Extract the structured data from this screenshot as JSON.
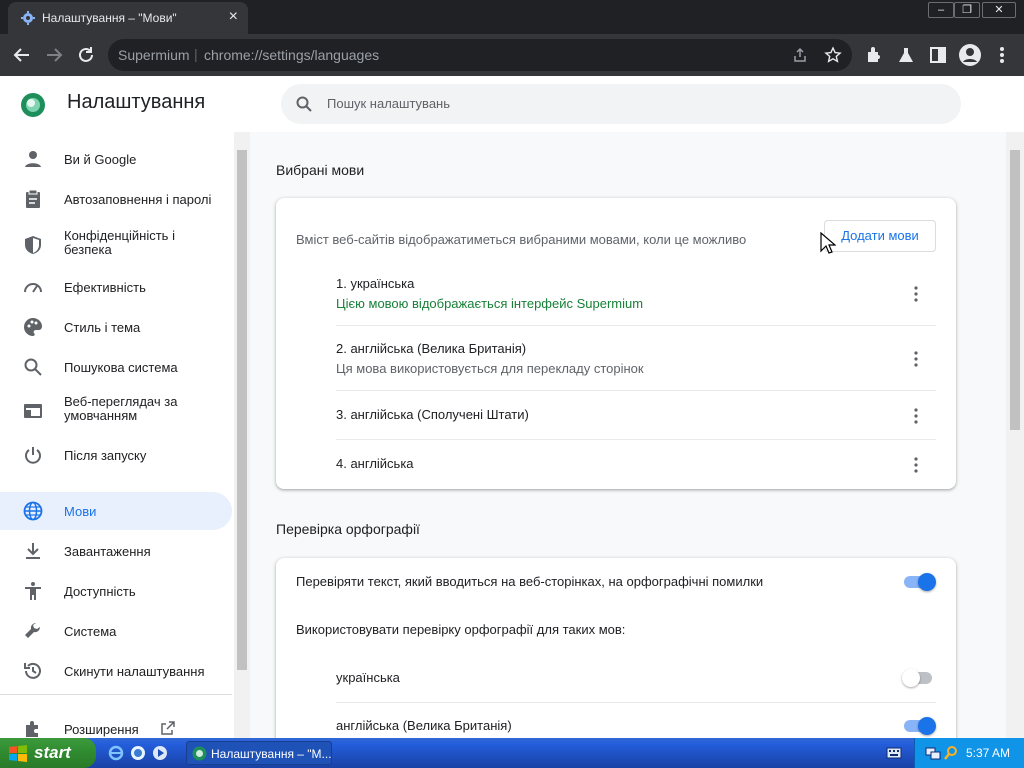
{
  "browser": {
    "tab_title": "Налаштування – \"Мови\"",
    "url_domain": "Supermium",
    "url_path": "chrome://settings/languages",
    "window_buttons": [
      "–",
      "❐",
      "✕"
    ]
  },
  "settings": {
    "title": "Налаштування",
    "search_placeholder": "Пошук налаштувань",
    "sidebar": [
      {
        "label": "Ви й Google",
        "icon": "person-icon"
      },
      {
        "label": "Автозаповнення і паролі",
        "icon": "clipboard-icon"
      },
      {
        "label": "Конфіденційність і безпека",
        "icon": "shield-icon"
      },
      {
        "label": "Ефективність",
        "icon": "speedometer-icon"
      },
      {
        "label": "Стиль і тема",
        "icon": "palette-icon"
      },
      {
        "label": "Пошукова система",
        "icon": "search-icon"
      },
      {
        "label": "Веб-переглядач за умовчанням",
        "icon": "browser-icon"
      },
      {
        "label": "Після запуску",
        "icon": "power-icon"
      },
      {
        "label": "Мови",
        "icon": "globe-icon",
        "active": true
      },
      {
        "label": "Завантаження",
        "icon": "download-icon"
      },
      {
        "label": "Доступність",
        "icon": "accessibility-icon"
      },
      {
        "label": "Система",
        "icon": "wrench-icon"
      },
      {
        "label": "Скинути налаштування",
        "icon": "history-icon"
      },
      {
        "label": "Розширення",
        "icon": "puzzle-icon"
      }
    ],
    "preferred_languages": {
      "section_title": "Вибрані мови",
      "description": "Вміст веб-сайтів відображатиметься вибраними мовами, коли це можливо",
      "add_button": "Додати мови",
      "languages": [
        {
          "name": "1. українська",
          "note": "Цією мовою відображається інтерфейс Supermium"
        },
        {
          "name": "2. англійська (Велика Британія)",
          "note": "Ця мова використовується для перекладу сторінок"
        },
        {
          "name": "3. англійська (Сполучені Штати)",
          "note": ""
        },
        {
          "name": "4. англійська",
          "note": ""
        }
      ]
    },
    "spell_check": {
      "section_title": "Перевірка орфографії",
      "main_label": "Перевіряти текст, який вводиться на веб-сторінках, на орфографічні помилки",
      "main_enabled": true,
      "languages_label": "Використовувати перевірку орфографії для таких мов:",
      "languages": [
        {
          "name": "українська",
          "enabled": false
        },
        {
          "name": "англійська (Велика Британія)",
          "enabled": true
        }
      ]
    }
  },
  "taskbar": {
    "start_label": "start",
    "task_label": "Налаштування – \"М...",
    "clock": "5:37 AM"
  },
  "colors": {
    "accent": "#1a73e8",
    "green_note": "#188038",
    "xp_taskbar": "#245edb",
    "xp_start": "#2f8a2f"
  }
}
